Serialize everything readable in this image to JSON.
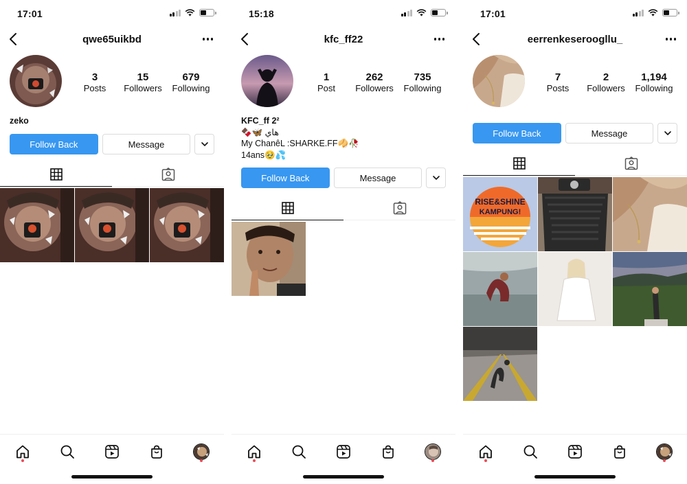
{
  "screens": [
    {
      "status_time": "17:01",
      "username": "qwe65uikbd",
      "stats": [
        {
          "num": "3",
          "label": "Posts"
        },
        {
          "num": "15",
          "label": "Followers"
        },
        {
          "num": "679",
          "label": "Following"
        }
      ],
      "bio_name": "zeko",
      "bio_lines": [],
      "follow_label": "Follow Back",
      "message_label": "Message",
      "grid_count": 3
    },
    {
      "status_time": "15:18",
      "username": "kfc_ff22",
      "stats": [
        {
          "num": "1",
          "label": "Post"
        },
        {
          "num": "262",
          "label": "Followers"
        },
        {
          "num": "735",
          "label": "Following"
        }
      ],
      "bio_name": "KFC_ff 2²",
      "bio_lines": [
        "🍫🦋 هاي",
        "My ChanêL :SHARKE.FF🥠🥀",
        "14ans🥹💦"
      ],
      "follow_label": "Follow Back",
      "message_label": "Message",
      "grid_count": 1
    },
    {
      "status_time": "17:01",
      "username": "eerrenkeseroogllu_",
      "stats": [
        {
          "num": "7",
          "label": "Posts"
        },
        {
          "num": "2",
          "label": "Followers"
        },
        {
          "num": "1,194",
          "label": "Following"
        }
      ],
      "bio_name": "",
      "bio_lines": [],
      "follow_label": "Follow Back",
      "message_label": "Message",
      "grid_count": 7,
      "post_text": [
        "RISE&SHINE",
        "KAMPUNG!"
      ]
    }
  ],
  "icons": {
    "back": "chevron-left-icon",
    "more": "more-horizontal-icon",
    "grid_tab": "grid-icon",
    "tagged_tab": "tagged-person-icon",
    "dropdown": "chevron-down-icon",
    "nav": [
      "home-icon",
      "search-icon",
      "reels-icon",
      "shop-icon",
      "profile-avatar"
    ]
  },
  "colors": {
    "follow_button": "#3897f0",
    "notification_dot": "#ed4956",
    "text": "#111111",
    "border": "#dbdbdb"
  }
}
